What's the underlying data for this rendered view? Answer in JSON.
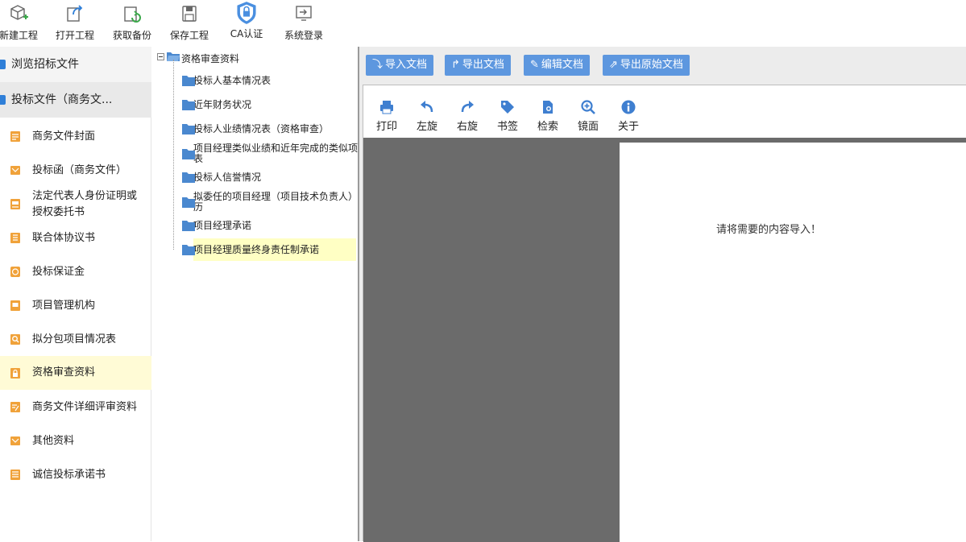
{
  "toolbar": {
    "new_project": "新建工程",
    "open_project": "打开工程",
    "get_backup": "获取备份",
    "save_project": "保存工程",
    "ca_auth": "CA认证",
    "system_login": "系统登录"
  },
  "sidebar": {
    "browse_tender": "浏览招标文件",
    "bid_file": "投标文件（商务文...",
    "items": [
      "商务文件封面",
      "投标函（商务文件）",
      "法定代表人身份证明或授权委托书",
      "联合体协议书",
      "投标保证金",
      "项目管理机构",
      "拟分包项目情况表",
      "资格审查资料",
      "商务文件详细评审资料",
      "其他资料",
      "诚信投标承诺书"
    ],
    "item_multi_line": [
      "法定代表人身份证明或",
      "授权委托书"
    ]
  },
  "tree": {
    "root": "资格审查资料",
    "nodes": [
      "投标人基本情况表",
      "近年财务状况",
      "投标人业绩情况表（资格审查）",
      "项目经理类似业绩和近年完成的类似项",
      "表",
      "投标人信誉情况",
      "拟委任的项目经理（项目技术负责人）",
      "历",
      "项目经理承诺",
      "项目经理质量终身责任制承诺"
    ]
  },
  "doc_buttons": {
    "import": "导入文档",
    "export": "导出文档",
    "edit": "编辑文档",
    "export_original": "导出原始文档"
  },
  "viewer": {
    "print": "打印",
    "rotate_left": "左旋",
    "rotate_right": "右旋",
    "bookmark": "书签",
    "search": "检索",
    "mirror": "镜面",
    "about": "关于",
    "message": "请将需要的内容导入！"
  },
  "colors": {
    "accent_blue": "#5d97df",
    "sidebar_active": "#fffbd6",
    "icon_orange": "#f0a23a",
    "viewer_gray": "#6b6b6b"
  }
}
